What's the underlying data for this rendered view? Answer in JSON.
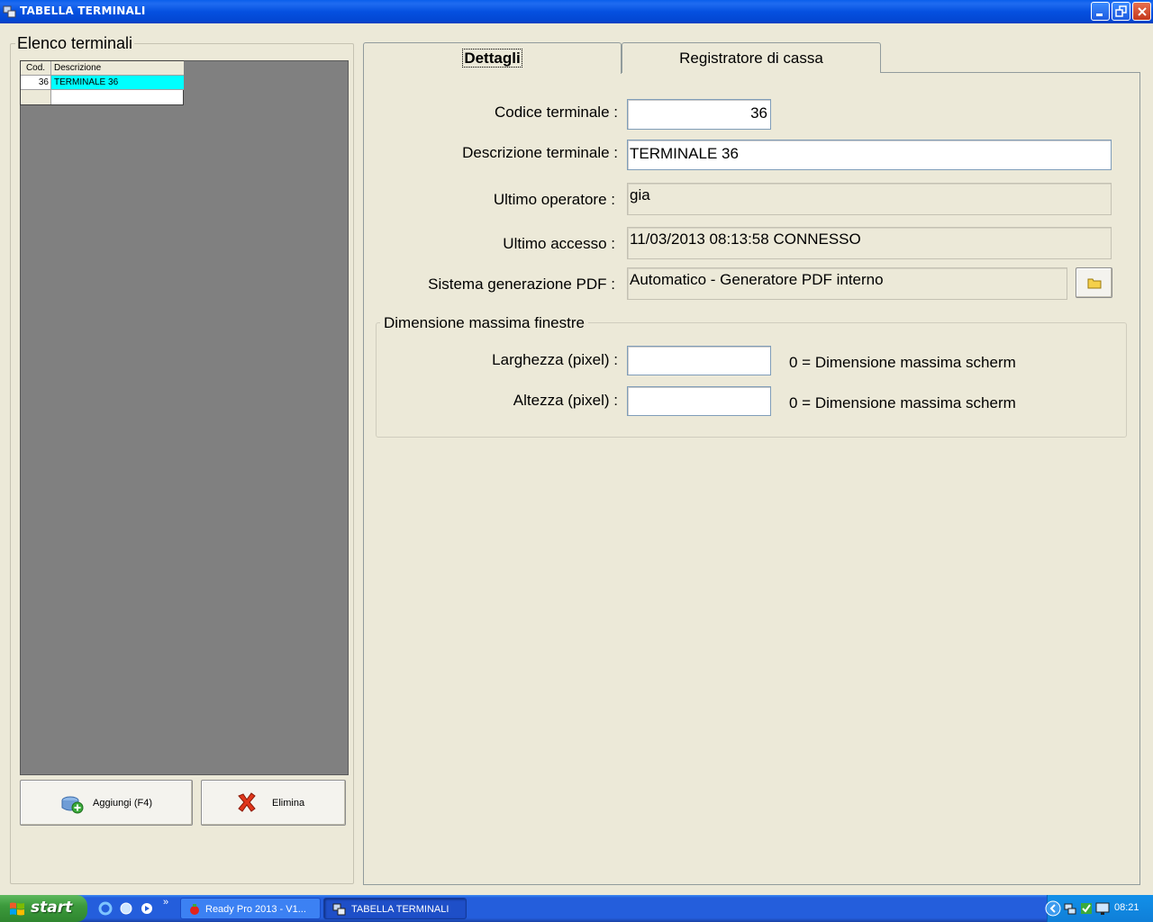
{
  "window": {
    "title": "TABELLA TERMINALI"
  },
  "left": {
    "group_title": "Elenco terminali",
    "grid": {
      "headers": [
        "Cod.",
        "Descrizione"
      ],
      "rows": [
        {
          "cod": "36",
          "descrizione": "TERMINALE 36"
        }
      ]
    },
    "buttons": {
      "add": "Aggiungi (F4)",
      "delete": "Elimina"
    }
  },
  "tabs": [
    {
      "label": "Dettagli"
    },
    {
      "label": "Registratore di cassa"
    }
  ],
  "details": {
    "codice_label": "Codice terminale :",
    "codice_value": "36",
    "descrizione_label": "Descrizione terminale :",
    "descrizione_value": "TERMINALE 36",
    "operatore_label": "Ultimo operatore :",
    "operatore_value": "gia",
    "accesso_label": "Ultimo accesso :",
    "accesso_value": "11/03/2013  08:13:58  CONNESSO",
    "pdf_label": "Sistema generazione PDF :",
    "pdf_value": "Automatico - Generatore PDF interno",
    "dim_group_title": "Dimensione massima finestre",
    "larghezza_label": "Larghezza (pixel) :",
    "larghezza_value": "",
    "larghezza_hint": "0 =  Dimensione massima scherm",
    "altezza_label": "Altezza (pixel) :",
    "altezza_value": "",
    "altezza_hint": "0 =  Dimensione massima scherm"
  },
  "taskbar": {
    "start_label": "start",
    "tasks": [
      "Ready Pro 2013 - V1...",
      "TABELLA TERMINALI"
    ],
    "clock": "08:21"
  }
}
